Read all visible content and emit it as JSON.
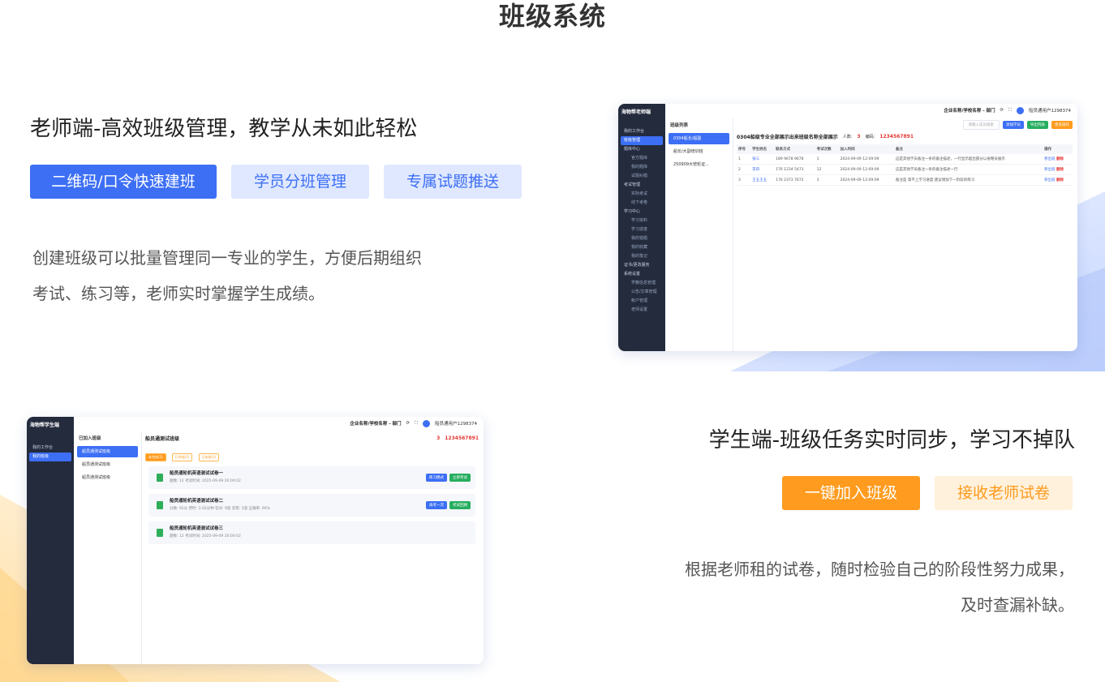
{
  "page_title": "班级系统",
  "teacher": {
    "heading": "老师端-高效班级管理，教学从未如此轻松",
    "tags": [
      "二维码/口令快速建班",
      "学员分班管理",
      "专属试题推送"
    ],
    "desc_line1": "创建班级可以批量管理同一专业的学生，方便后期组织",
    "desc_line2": "考试、练习等，老师实时掌握学生成绩。"
  },
  "student": {
    "heading": "学生端-班级任务实时同步，学习不掉队",
    "tags": [
      "一键加入班级",
      "接收老师试卷"
    ],
    "desc_line1": "根据老师租的试卷，随时检验自己的阶段性努力成果，",
    "desc_line2": "及时查漏补缺。"
  },
  "teacher_app": {
    "logo": "海物帮老师端",
    "topbar": {
      "brand": "企业名称/学校名称 - 部门",
      "user": "船员通用户1298374"
    },
    "sidebar": [
      "我的工作台",
      "班级管理",
      "题库中心",
      "官方题库",
      "我的题库",
      "试题纠错",
      "考试管理",
      "实际考试",
      "线下考卷",
      "学习中心",
      "学习资料",
      "学习进度",
      "我的错题",
      "我的收藏",
      "我的笔记",
      "证书/更改服务",
      "系统设置",
      "学籍信息管理",
      "公告/文章管理",
      "帐户管理",
      "老师设置"
    ],
    "class_list_title": "班级列表",
    "classes": [
      "0304船长/船副",
      "船长/大副培训班",
      "250909大管轮证..."
    ],
    "content_title": "0304船级专业全部展示出来班级名称全部展示",
    "count_label": "人数:",
    "count": "3",
    "code_label": "编码:",
    "code": "1234567891",
    "search_placeholder": "请输入成员搜索",
    "buttons": [
      "添加学员",
      "导出列表",
      "更多操作"
    ],
    "columns": [
      "序号",
      "学生姓名",
      "联系方式",
      "考试次数",
      "加入时间",
      "备注",
      "操作"
    ],
    "rows": [
      {
        "no": "1",
        "name": "张三",
        "phone": "189 9678 9678",
        "times": "1",
        "time": "2024-09-09 12:09:09",
        "note": "这是其他学员备注一条的备注描述，一行显示超出部分以省略号展示",
        "op1": "移出班",
        "op2": "删除"
      },
      {
        "no": "2",
        "name": "李四",
        "phone": "176 1234 5473",
        "times": "12",
        "time": "2024-09-09 12:09:09",
        "note": "这是其他学员备注一条的备注描述一行",
        "op1": "移出班",
        "op2": "删除"
      },
      {
        "no": "3",
        "name": "王五王五",
        "phone": "176 2373 7672",
        "times": "3",
        "time": "2024-09-09 12:09:09",
        "note": "备注是 第不上学习进度 建议增加下一阶段的练习",
        "op1": "移出班",
        "op2": "删除"
      }
    ]
  },
  "student_app": {
    "logo": "海物帮学生端",
    "topbar": {
      "brand": "企业名称/学校名称 - 部门",
      "user": "船员通用户1298374"
    },
    "sidebar": [
      "我的工作台",
      "我的班级"
    ],
    "joined_title": "已加入班级",
    "classes": [
      "船员通测试班级",
      "船员通测试班级",
      "船员通测试班级"
    ],
    "content_title": "船员通测试班级",
    "count": "3",
    "code": "1234567891",
    "filters": [
      "未完成(2)",
      "已完成(1)",
      "已失效(2)"
    ],
    "papers": [
      {
        "title": "船员通轮机英语测试试卷一",
        "meta": "题数: 12     考试时间: 2025-09-09 20:00:02",
        "b1": "练习模式",
        "b2": "立即考试"
      },
      {
        "title": "船员通轮机英语测试试卷二",
        "meta": "分数: 92分  用时: 3.02分钟  答对: 9道  答错: 3道  正确率: 90%",
        "b1": "再考一次",
        "b2": "考试回顾"
      },
      {
        "title": "船员通轮机英语测试试卷三",
        "meta": "题数: 12     考试时间: 2025-09-09 20:00:02",
        "b1": "",
        "b2": ""
      }
    ]
  }
}
